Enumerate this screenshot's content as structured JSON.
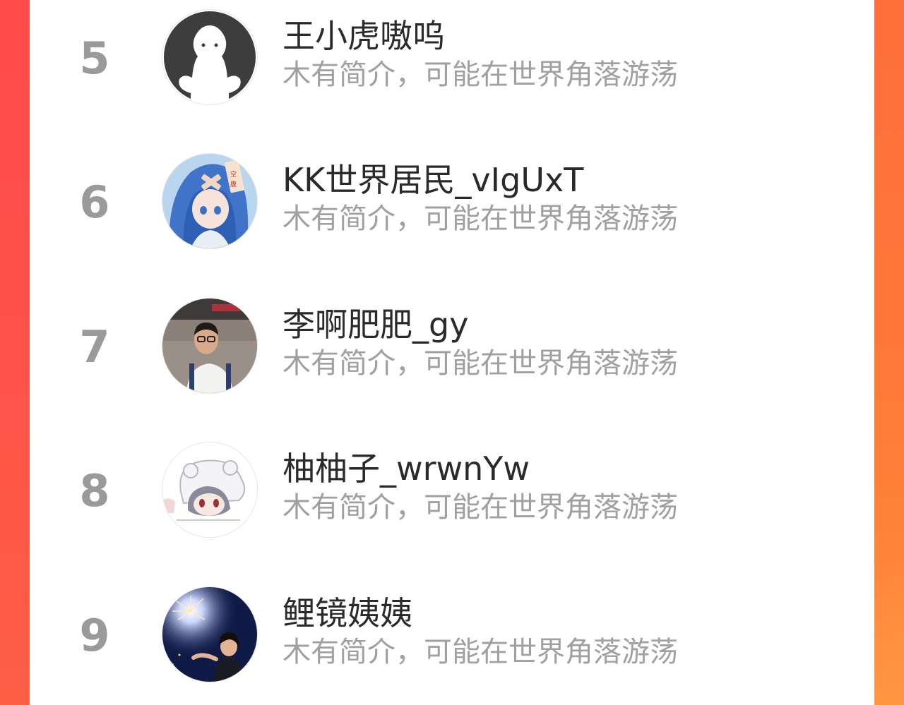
{
  "ranking": {
    "rows": [
      {
        "rank": "5",
        "name": "王小虎嗷呜",
        "bio": "木有简介，可能在世界角落游荡",
        "avatar_icon": "default-ghost-avatar"
      },
      {
        "rank": "6",
        "name": "KK世界居民_vIgUxT",
        "bio": "木有简介，可能在世界角落游荡",
        "avatar_icon": "anime-girl-blue-hair-avatar"
      },
      {
        "rank": "7",
        "name": "李啊肥肥_gy",
        "bio": "木有简介，可能在世界角落游荡",
        "avatar_icon": "photo-man-glasses-avatar"
      },
      {
        "rank": "8",
        "name": "柚柚子_wrwnYw",
        "bio": "木有简介，可能在世界角落游荡",
        "avatar_icon": "anime-sheep-hood-avatar"
      },
      {
        "rank": "9",
        "name": "鲤镜姨姨",
        "bio": "木有简介，可能在世界角落游荡",
        "avatar_icon": "photo-girl-sparkler-avatar"
      }
    ]
  },
  "colors": {
    "background_left": "#ff4b49",
    "background_right": "#ff7a38",
    "rank_text": "#9a9a9a",
    "name_text": "#2a2a2a",
    "bio_text": "#a0a0a0"
  }
}
